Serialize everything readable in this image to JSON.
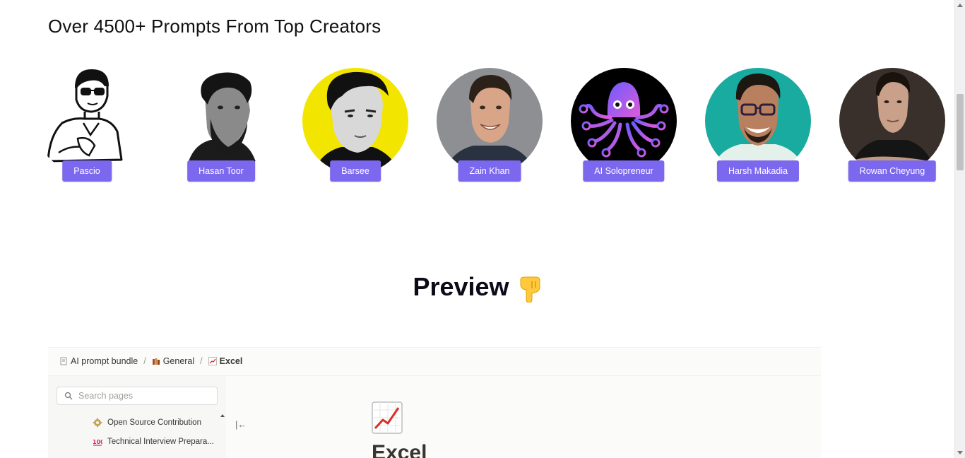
{
  "section": {
    "title": "Over 4500+ Prompts From Top Creators"
  },
  "creators": [
    {
      "name": "Pascio",
      "avatar_icon": "cartoon-sunglasses-avatar"
    },
    {
      "name": "Hasan Toor",
      "avatar_icon": "bearded-man-avatar"
    },
    {
      "name": "Barsee",
      "avatar_icon": "man-yellow-background-avatar"
    },
    {
      "name": "Zain Khan",
      "avatar_icon": "smiling-man-avatar"
    },
    {
      "name": "AI Solopreneur",
      "avatar_icon": "octopus-logo-avatar"
    },
    {
      "name": "Harsh Makadia",
      "avatar_icon": "man-glasses-teal-avatar"
    },
    {
      "name": "Rowan Cheyung",
      "avatar_icon": "man-dark-background-avatar"
    }
  ],
  "preview": {
    "title": "Preview",
    "emoji_icon": "backhand-index-pointing-down-icon"
  },
  "notion": {
    "breadcrumbs": [
      {
        "label": "AI prompt bundle",
        "icon": "document-icon"
      },
      {
        "label": "General",
        "icon": "books-icon"
      },
      {
        "label": "Excel",
        "icon": "chart-increasing-icon"
      }
    ],
    "search_placeholder": "Search pages",
    "pages": [
      {
        "label": "Open Source Contribution",
        "icon": "gear-icon"
      },
      {
        "label": "Technical Interview Prepara...",
        "icon": "hundred-points-icon"
      }
    ],
    "collapse_glyph": "|←",
    "page_title": "Excel",
    "page_icon": "chart-increasing-icon"
  },
  "colors": {
    "accent": "#7b68ee",
    "page_bg": "#ffffff",
    "heading": "#0b0b1a"
  }
}
